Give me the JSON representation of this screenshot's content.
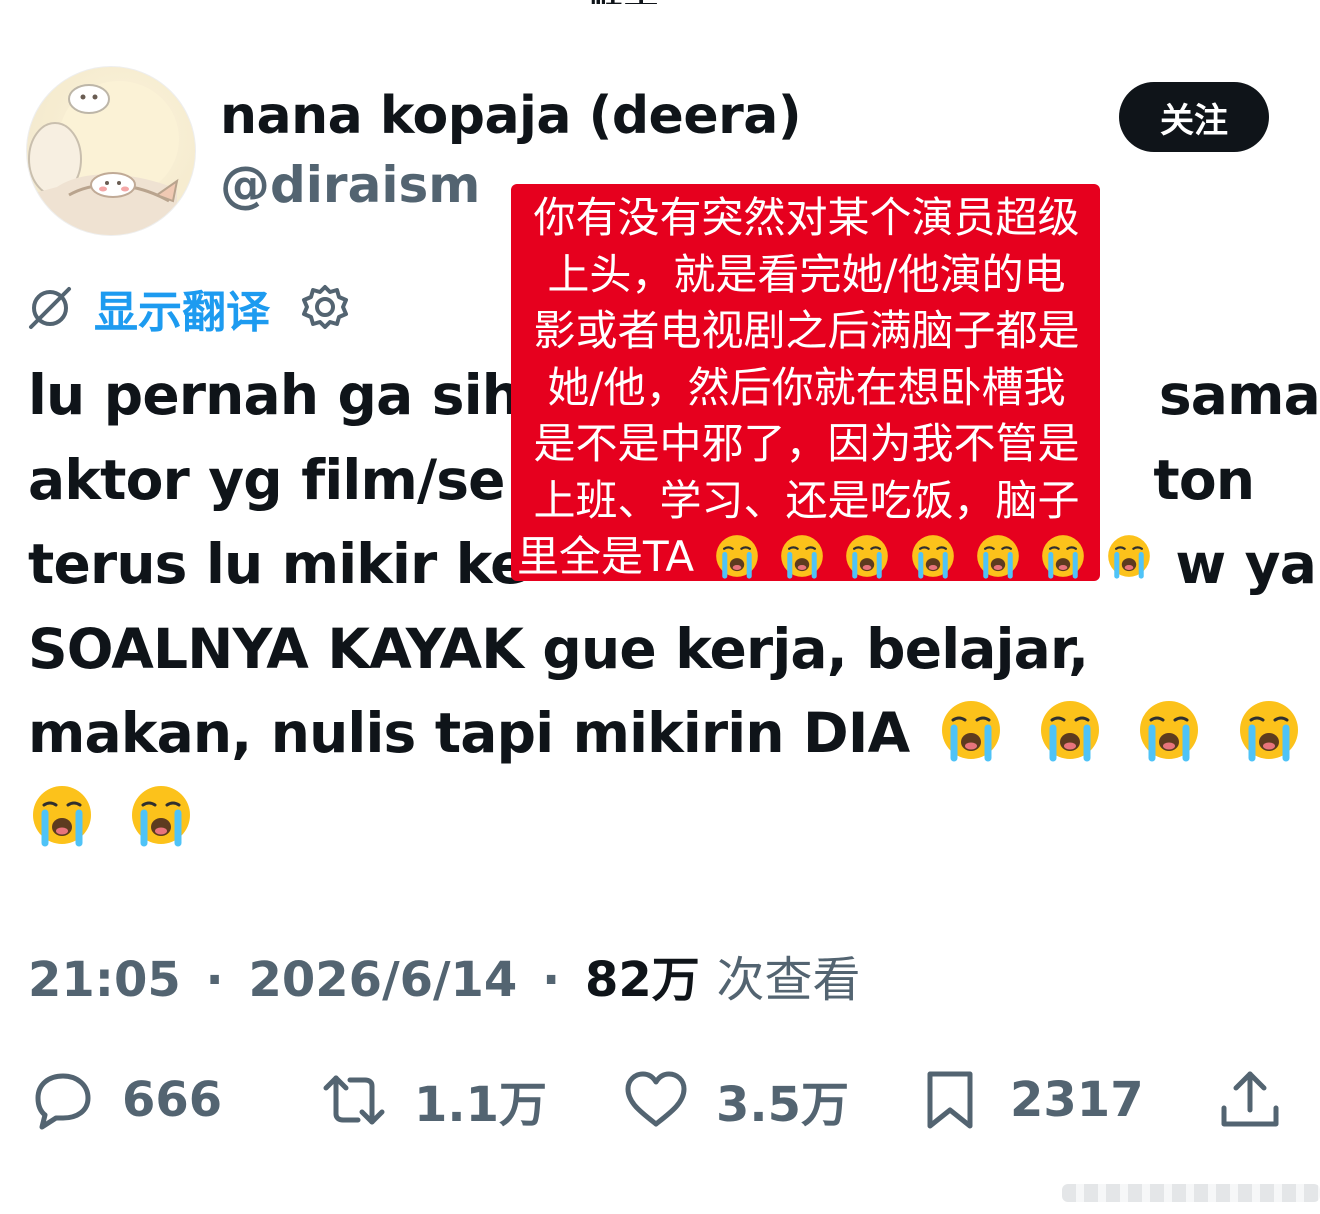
{
  "author": {
    "display_name": "nana kopaja (deera)",
    "handle": "@diraism"
  },
  "follow_button": {
    "label": "关注"
  },
  "translate": {
    "label": "显示翻译"
  },
  "tweet": {
    "lines": [
      "lu pernah ga sih",
      "sama",
      "aktor yg film/se",
      "ton",
      "terus lu mikir ke",
      "w ya",
      "SOALNYA KAYAK gue kerja, belajar,",
      "makan, nulis tapi mikirin DIA"
    ]
  },
  "overlay_translation": {
    "lines": [
      "你有没有突然对某个演员超级",
      "上头，就是看完她/他演的电",
      "影或者电视剧之后满脑子都是",
      "她/他，然后你就在想卧槽我",
      "是不是中邪了，因为我不管是",
      "上班、学习、还是吃饭，脑子",
      "里全是TA"
    ]
  },
  "meta": {
    "time": "21:05",
    "separator": "·",
    "date": "2026/6/14",
    "views_count": "82万",
    "views_label": "次查看"
  },
  "actions": {
    "replies": "666",
    "reposts": "1.1万",
    "likes": "3.5万",
    "bookmarks": "2317"
  },
  "colors": {
    "text_primary": "#0f1419",
    "text_secondary": "#536471",
    "accent": "#1d9bf0",
    "overlay_red": "#e6001e"
  },
  "icons": {
    "translate": "translate-slash-icon",
    "gear": "gear-icon",
    "crying_emoji": "loudly-crying-face-emoji",
    "reply": "speech-bubble-icon",
    "repost": "repost-arrows-icon",
    "like": "heart-icon",
    "bookmark": "bookmark-icon",
    "share": "share-upload-icon"
  }
}
